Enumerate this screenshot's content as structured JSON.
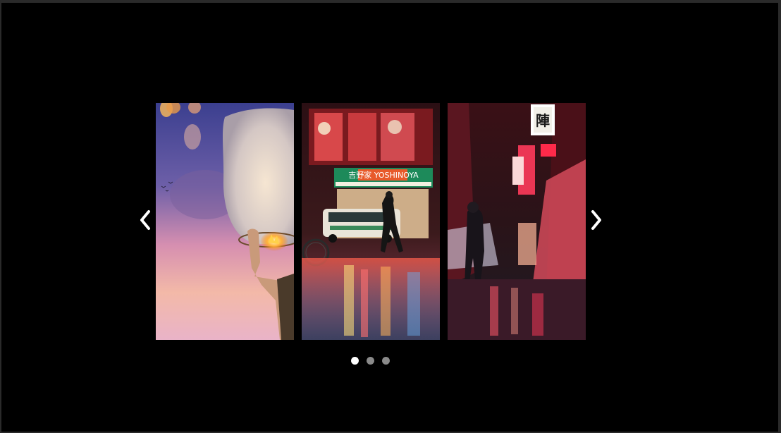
{
  "carousel": {
    "slides": [
      {
        "name": "sky-lantern-photo",
        "text": ""
      },
      {
        "name": "tokyo-street-yoshinoya-photo",
        "text": "吉野家 YOSHINOYA"
      },
      {
        "name": "neon-alley-photo",
        "text": "陣"
      }
    ],
    "prev_icon": "chevron-left-icon",
    "next_icon": "chevron-right-icon",
    "pagination": {
      "count": 3,
      "active_index": 0
    },
    "colors": {
      "background": "#000000",
      "frame": "#2a2a2a",
      "dot_active": "#ffffff",
      "dot_inactive": "#8a8a8a",
      "arrow": "#ffffff"
    }
  }
}
